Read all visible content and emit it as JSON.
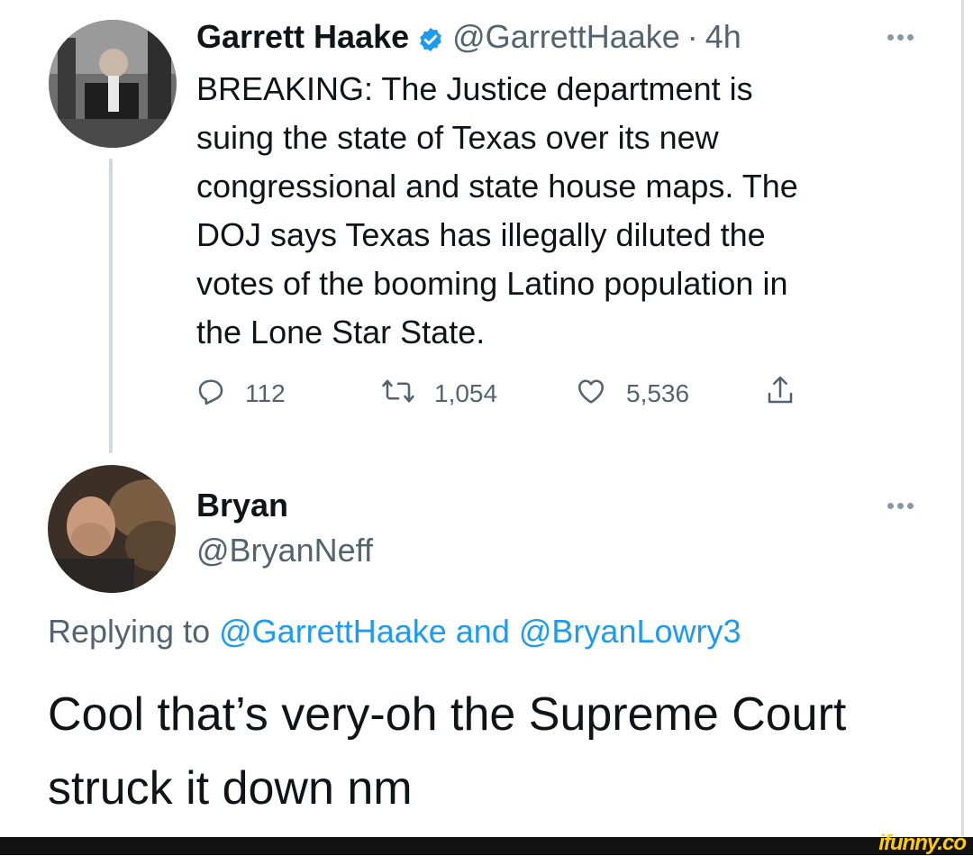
{
  "tweet": {
    "author_name": "Garrett Haake",
    "handle": "@GarrettHaake",
    "separator": "·",
    "time": "4h",
    "text": "BREAKING: The Justice department is\nsuing the state of Texas over its new\ncongressional and state house maps. The\nDOJ says Texas has illegally diluted the\nvotes of the booming Latino population in\nthe Lone Star State.",
    "reply_count": "112",
    "retweet_count": "1,054",
    "like_count": "5,536",
    "icons": [
      "reply-icon",
      "retweet-icon",
      "like-icon",
      "share-icon",
      "verified-badge-icon",
      "more-options-icon"
    ],
    "verified_color": "#1d9bf0"
  },
  "reply": {
    "author_name": "Bryan",
    "handle": "@BryanNeff",
    "replying_prefix": "Replying to",
    "mention_1": "@GarrettHaake",
    "mention_joiner": "and",
    "mention_2": "@BryanLowry3",
    "text": "Cool that’s very-oh the Supreme Court\nstruck it down nm",
    "mention_color": "#1d9bf0"
  },
  "watermark": {
    "text": "ifunny.co"
  }
}
